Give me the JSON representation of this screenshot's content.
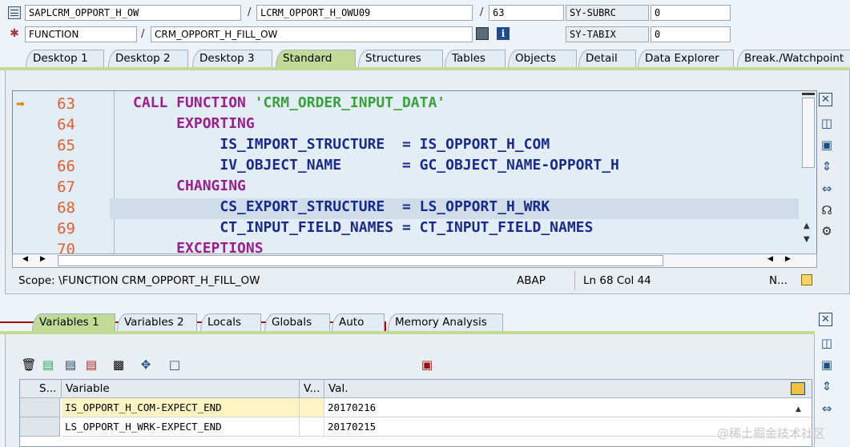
{
  "header": {
    "program": "SAPLCRM_OPPORT_H_OW",
    "include": "LCRM_OPPORT_H_OWU09",
    "line": "63",
    "event_type": "FUNCTION",
    "event_name": "CRM_OPPORT_H_FILL_OW",
    "sy_subrc_label": "SY-SUBRC",
    "sy_subrc_value": "0",
    "sy_tabix_label": "SY-TABIX",
    "sy_tabix_value": "0",
    "slash": "/"
  },
  "top_tabs": [
    {
      "label": "Desktop 1",
      "active": false
    },
    {
      "label": "Desktop 2",
      "active": false
    },
    {
      "label": "Desktop 3",
      "active": false
    },
    {
      "label": "Standard",
      "active": true
    },
    {
      "label": "Structures",
      "active": false
    },
    {
      "label": "Tables",
      "active": false
    },
    {
      "label": "Objects",
      "active": false
    },
    {
      "label": "Detail",
      "active": false
    },
    {
      "label": "Data Explorer",
      "active": false
    },
    {
      "label": "Break./Watchpoint",
      "active": false
    }
  ],
  "editor": {
    "line_numbers": [
      "63",
      "64",
      "65",
      "66",
      "67",
      "68",
      "69",
      "70"
    ],
    "current_line": "63",
    "highlighted_line": "68",
    "code": [
      [
        {
          "t": "CALL FUNCTION ",
          "c": "kw"
        },
        {
          "t": "'CRM_ORDER_INPUT_DATA'",
          "c": "st"
        }
      ],
      [
        {
          "t": "     EXPORTING",
          "c": "kw"
        }
      ],
      [
        {
          "t": "          IS_IMPORT_STRUCTURE  = IS_OPPORT_H_COM",
          "c": "id"
        }
      ],
      [
        {
          "t": "          IV_OBJECT_NAME       = GC_OBJECT_NAME-OPPORT_H",
          "c": "id"
        }
      ],
      [
        {
          "t": "     CHANGING",
          "c": "kw"
        }
      ],
      [
        {
          "t": "          CS_EXPORT_STRUCTURE  = LS_OPPORT_H_WRK",
          "c": "id"
        }
      ],
      [
        {
          "t": "          CT_INPUT_FIELD_NAMES = CT_INPUT_FIELD_NAMES",
          "c": "id"
        }
      ],
      [
        {
          "t": "     EXCEPTIONS",
          "c": "kw"
        }
      ]
    ]
  },
  "status": {
    "scope": "Scope: \\FUNCTION CRM_OPPORT_H_FILL_OW",
    "language": "ABAP",
    "position": "Ln  68 Col  44",
    "mode": "N..."
  },
  "bottom_tabs": [
    {
      "label": "Variables 1",
      "active": true
    },
    {
      "label": "Variables 2",
      "active": false
    },
    {
      "label": "Locals",
      "active": false
    },
    {
      "label": "Globals",
      "active": false
    },
    {
      "label": "Auto",
      "active": false
    },
    {
      "label": "Memory Analysis",
      "active": false
    }
  ],
  "variables": {
    "columns": [
      "S...",
      "Variable",
      "V...",
      "Val."
    ],
    "rows": [
      {
        "variable": "IS_OPPORT_H_COM-EXPECT_END",
        "value": "20170216"
      },
      {
        "variable": "LS_OPPORT_H_WRK-EXPECT_END",
        "value": "20170215"
      }
    ]
  },
  "watermark": "@稀土掘金技术社区",
  "colors": {
    "active_tab": "#bfdb96",
    "keyword": "#9a1f8c",
    "string": "#38a23a",
    "identifier": "#1a2a8a",
    "line_number": "#e06030",
    "selected_cell": "#fff3c4"
  }
}
